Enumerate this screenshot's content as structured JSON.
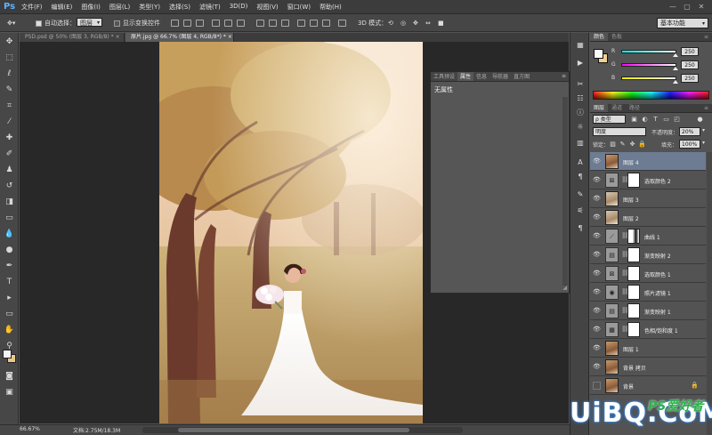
{
  "menubar": {
    "logo": "Ps",
    "items": [
      "文件(F)",
      "编辑(E)",
      "图像(I)",
      "图层(L)",
      "类型(Y)",
      "选择(S)",
      "滤镜(T)",
      "3D(D)",
      "视图(V)",
      "窗口(W)",
      "帮助(H)"
    ],
    "window_controls": [
      "—",
      "▢",
      "✕"
    ]
  },
  "options": {
    "auto_select_label": "自动选择：",
    "auto_select_value": "图层",
    "transform_label": "显示变换控件",
    "mode_3d": "3D 模式：",
    "workspace": "基本功能"
  },
  "doc_tabs": [
    {
      "label": "PSD.psd @ 50% (图层 3, RGB/8) *",
      "close": "×"
    },
    {
      "label": "原片.jpg @ 66.7% (图层 4, RGB/8*) *",
      "close": "×"
    }
  ],
  "properties_panel": {
    "tabs": [
      "工具预设",
      "属性",
      "信息",
      "导航器",
      "直方图"
    ],
    "active_tab": 1,
    "empty_text": "无属性"
  },
  "status": {
    "zoom": "66.67%",
    "doc_info": "文档:2.75M/18.3M"
  },
  "color_panel": {
    "tabs": [
      "颜色",
      "色板"
    ],
    "sliders": [
      {
        "label": "R",
        "value": "250",
        "fraction": 0.98,
        "gradient": "linear-gradient(to right, #00fafa, #fafafa)"
      },
      {
        "label": "G",
        "value": "250",
        "fraction": 0.98,
        "gradient": "linear-gradient(to right, #fa00fa, #fafafa)"
      },
      {
        "label": "B",
        "value": "250",
        "fraction": 0.98,
        "gradient": "linear-gradient(to right, #fafa00, #fafafa)"
      }
    ]
  },
  "layers_panel": {
    "tabs": [
      "图层",
      "通道",
      "路径"
    ],
    "filter_label": "ρ 类型",
    "blend_mode": "明度",
    "opacity_label": "不透明度：",
    "opacity_value": "20%",
    "lock_label": "锁定：",
    "fill_label": "填充：",
    "fill_value": "100%",
    "layers": [
      {
        "name": "图层 4",
        "type": "photo",
        "selected": true
      },
      {
        "name": "选取颜色 2",
        "type": "adj",
        "glyph": "⊠",
        "mask": true
      },
      {
        "name": "图层 3",
        "type": "photo2"
      },
      {
        "name": "图层 2",
        "type": "photo2"
      },
      {
        "name": "曲线 1",
        "type": "adj",
        "glyph": "⟋",
        "mask": true,
        "curves": true
      },
      {
        "name": "渐变映射 2",
        "type": "adj",
        "glyph": "▤",
        "mask": true
      },
      {
        "name": "选取颜色 1",
        "type": "adj",
        "glyph": "⊠",
        "mask": true
      },
      {
        "name": "照片滤镜 1",
        "type": "adj",
        "glyph": "◉",
        "mask": true
      },
      {
        "name": "渐变映射 1",
        "type": "adj",
        "glyph": "▤",
        "mask": true
      },
      {
        "name": "色相/饱和度 1",
        "type": "adj",
        "glyph": "▦",
        "mask": true
      },
      {
        "name": "图层 1",
        "type": "photo"
      },
      {
        "name": "背景 拷贝",
        "type": "photo"
      },
      {
        "name": "背景",
        "type": "photo",
        "locked": true,
        "hidden": true
      }
    ]
  },
  "watermark": {
    "main": "UiBQ.CoM",
    "small": "PS爱好者"
  },
  "colors": {
    "accent": "#5fb3ff",
    "selected_layer": "#6d7c92",
    "background_swatch": "#e6c98c"
  }
}
